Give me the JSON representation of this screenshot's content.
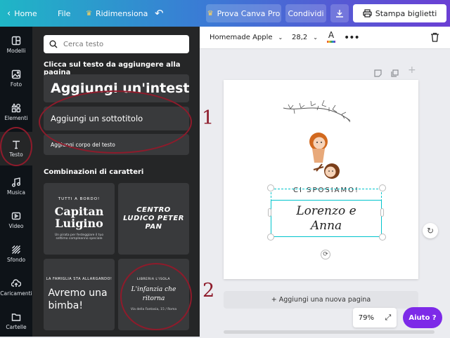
{
  "topbar": {
    "home_label": "Home",
    "file_label": "File",
    "resize_label": "Ridimensiona",
    "pro_label": "Prova Canva Pro",
    "share_label": "Condividi",
    "print_label": "Stampa biglietti"
  },
  "sidebar": {
    "items": [
      {
        "label": "Modelli",
        "icon": "layout-icon"
      },
      {
        "label": "Foto",
        "icon": "photo-icon"
      },
      {
        "label": "Elementi",
        "icon": "shapes-icon"
      },
      {
        "label": "Testo",
        "icon": "text-icon"
      },
      {
        "label": "Musica",
        "icon": "music-icon"
      },
      {
        "label": "Video",
        "icon": "video-icon"
      },
      {
        "label": "Sfondo",
        "icon": "background-icon"
      },
      {
        "label": "Caricamenti",
        "icon": "cloud-upload-icon"
      },
      {
        "label": "Cartelle",
        "icon": "folder-icon"
      }
    ]
  },
  "panel": {
    "search_placeholder": "Cerca testo",
    "instruction": "Clicca sul testo da aggiungere alla pagina",
    "heading_label": "Aggiungi un'intesta",
    "subtitle_label": "Aggiungi un sottotitolo",
    "body_label": "Aggiungi corpo del testo",
    "combos_title": "Combinazioni di caratteri",
    "combos": [
      {
        "top": "TUTTI A BORDO!",
        "main": "Capitan Luigino",
        "bottom": "Un pirata per festeggiare il tuo settimo compleanno speciale"
      },
      {
        "top": "",
        "main": "CENTRO LUDICO PETER PAN",
        "bottom": ""
      },
      {
        "top": "LA FAMIGLIA STA ALLARGANDO!",
        "main": "Avremo una bimba!",
        "bottom": ""
      },
      {
        "top": "LIBRERIA L'ISOLA",
        "main": "L'infanzia che ritorna",
        "bottom": "Via della Fantasia, 15 / Roma"
      }
    ]
  },
  "editor": {
    "font_name": "Homemade Apple",
    "font_size": "28,2",
    "card_top_text": "CI SPOSIAMO!",
    "card_names": "Lorenzo e Anna",
    "add_page_label": "+ Aggiungi una nuova pagina",
    "zoom": "79%",
    "help_label": "Aiuto ?"
  },
  "annotations": {
    "one": "1",
    "two": "2"
  },
  "colors": {
    "annotation_red": "#8e1b2b",
    "help_purple": "#7d2ae8",
    "selection_cyan": "#00c4cc"
  }
}
